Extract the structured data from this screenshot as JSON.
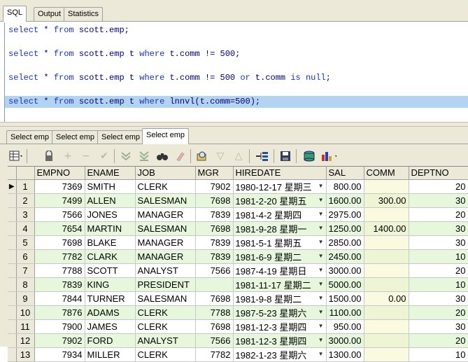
{
  "top_tabs": [
    "SQL",
    "Output",
    "Statistics"
  ],
  "editor": {
    "lines": [
      [
        {
          "t": "select",
          "c": "kw"
        },
        {
          "t": " * "
        },
        {
          "t": "from",
          "c": "kw"
        },
        {
          "t": " scott.emp;"
        }
      ],
      [],
      [
        {
          "t": "select",
          "c": "kw"
        },
        {
          "t": " * "
        },
        {
          "t": "from",
          "c": "kw"
        },
        {
          "t": " scott.emp t "
        },
        {
          "t": "where",
          "c": "kw"
        },
        {
          "t": " t.comm != 500;"
        }
      ],
      [],
      [
        {
          "t": "select",
          "c": "kw"
        },
        {
          "t": " * "
        },
        {
          "t": "from",
          "c": "kw"
        },
        {
          "t": " scott.emp t "
        },
        {
          "t": "where",
          "c": "kw"
        },
        {
          "t": " t.comm != 500 "
        },
        {
          "t": "or",
          "c": "kw"
        },
        {
          "t": " t.comm "
        },
        {
          "t": "is",
          "c": "kw"
        },
        {
          "t": " "
        },
        {
          "t": "null",
          "c": "kw"
        },
        {
          "t": ";"
        }
      ],
      [],
      [
        {
          "t": "select",
          "c": "kw"
        },
        {
          "t": " * "
        },
        {
          "t": "from",
          "c": "kw"
        },
        {
          "t": " scott.emp t "
        },
        {
          "t": "where",
          "c": "kw"
        },
        {
          "t": " lnnvl(t.comm=500);"
        }
      ]
    ],
    "highlighted_line": 6
  },
  "result_tabs": [
    "Select emp",
    "Select emp",
    "Select emp",
    "Select emp"
  ],
  "active_result_tab": 3,
  "toolbar": {
    "icons": [
      "grid-view-icon",
      "lock-icon",
      "add-record-icon",
      "delete-record-icon",
      "post-icon",
      "fetch-next-icon",
      "fetch-all-icon",
      "find-icon",
      "clear-icon",
      "query-by-example-icon",
      "filter-down-icon",
      "filter-up-icon",
      "tree-icon",
      "save-icon",
      "export-icon",
      "chart-icon"
    ]
  },
  "grid": {
    "columns": [
      "EMPNO",
      "ENAME",
      "JOB",
      "MGR",
      "HIREDATE",
      "SAL",
      "COMM",
      "DEPTNO"
    ],
    "current_row_marker": "▶",
    "rows": [
      {
        "n": "1",
        "empno": "7369",
        "ename": "SMITH",
        "job": "CLERK",
        "mgr": "7902",
        "hiredate": "1980-12-17 星期三",
        "sal": "800.00",
        "comm": "",
        "deptno": "20"
      },
      {
        "n": "2",
        "empno": "7499",
        "ename": "ALLEN",
        "job": "SALESMAN",
        "mgr": "7698",
        "hiredate": "1981-2-20 星期五",
        "sal": "1600.00",
        "comm": "300.00",
        "deptno": "30"
      },
      {
        "n": "3",
        "empno": "7566",
        "ename": "JONES",
        "job": "MANAGER",
        "mgr": "7839",
        "hiredate": "1981-4-2 星期四",
        "sal": "2975.00",
        "comm": "",
        "deptno": "20"
      },
      {
        "n": "4",
        "empno": "7654",
        "ename": "MARTIN",
        "job": "SALESMAN",
        "mgr": "7698",
        "hiredate": "1981-9-28 星期一",
        "sal": "1250.00",
        "comm": "1400.00",
        "deptno": "30"
      },
      {
        "n": "5",
        "empno": "7698",
        "ename": "BLAKE",
        "job": "MANAGER",
        "mgr": "7839",
        "hiredate": "1981-5-1 星期五",
        "sal": "2850.00",
        "comm": "",
        "deptno": "30"
      },
      {
        "n": "6",
        "empno": "7782",
        "ename": "CLARK",
        "job": "MANAGER",
        "mgr": "7839",
        "hiredate": "1981-6-9 星期二",
        "sal": "2450.00",
        "comm": "",
        "deptno": "10"
      },
      {
        "n": "7",
        "empno": "7788",
        "ename": "SCOTT",
        "job": "ANALYST",
        "mgr": "7566",
        "hiredate": "1987-4-19 星期日",
        "sal": "3000.00",
        "comm": "",
        "deptno": "20"
      },
      {
        "n": "8",
        "empno": "7839",
        "ename": "KING",
        "job": "PRESIDENT",
        "mgr": "",
        "hiredate": "1981-11-17 星期二",
        "sal": "5000.00",
        "comm": "",
        "deptno": "10"
      },
      {
        "n": "9",
        "empno": "7844",
        "ename": "TURNER",
        "job": "SALESMAN",
        "mgr": "7698",
        "hiredate": "1981-9-8 星期二",
        "sal": "1500.00",
        "comm": "0.00",
        "deptno": "30"
      },
      {
        "n": "10",
        "empno": "7876",
        "ename": "ADAMS",
        "job": "CLERK",
        "mgr": "7788",
        "hiredate": "1987-5-23 星期六",
        "sal": "1100.00",
        "comm": "",
        "deptno": "20"
      },
      {
        "n": "11",
        "empno": "7900",
        "ename": "JAMES",
        "job": "CLERK",
        "mgr": "7698",
        "hiredate": "1981-12-3 星期四",
        "sal": "950.00",
        "comm": "",
        "deptno": "30"
      },
      {
        "n": "12",
        "empno": "7902",
        "ename": "FORD",
        "job": "ANALYST",
        "mgr": "7566",
        "hiredate": "1981-12-3 星期四",
        "sal": "3000.00",
        "comm": "",
        "deptno": "20"
      },
      {
        "n": "13",
        "empno": "7934",
        "ename": "MILLER",
        "job": "CLERK",
        "mgr": "7782",
        "hiredate": "1982-1-23 星期六",
        "sal": "1300.00",
        "comm": "",
        "deptno": "10"
      }
    ]
  }
}
